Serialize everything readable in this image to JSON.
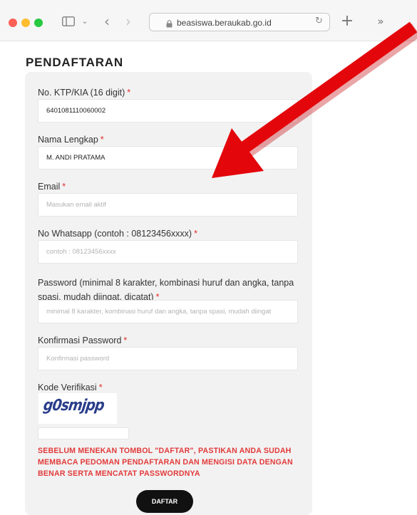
{
  "browser": {
    "url": "beasiswa.beraukab.go.id"
  },
  "page": {
    "title": "PENDAFTARAN"
  },
  "form": {
    "required_mark": "*",
    "ktp": {
      "label": "No. KTP/KIA (16 digit)",
      "value": "6401081110060002"
    },
    "name": {
      "label": "Nama Lengkap",
      "value": "M. ANDI PRATAMA"
    },
    "email": {
      "label": "Email",
      "placeholder": "Masukan email aktif"
    },
    "whatsapp": {
      "label": "No Whatsapp (contoh : 08123456xxxx)",
      "placeholder": "contoh : 08123456xxxx"
    },
    "password": {
      "label": "Password (minimal 8 karakter, kombinasi huruf dan angka, tanpa spasi, mudah diingat, dicatat)",
      "placeholder": "minimal 8 karakter, kombinasi huruf dan angka, tanpa spasi, mudah diingat"
    },
    "confirm_password": {
      "label": "Konfirmasi Password",
      "placeholder": "Konfirmasi password"
    },
    "captcha": {
      "label": "Kode Verifikasi",
      "image_text": "g0smjpp"
    },
    "warning": "SEBELUM MENEKAN TOMBOL \"DAFTAR\", PASTIKAN ANDA SUDAH MEMBACA PEDOMAN PENDAFTARAN DAN MENGISI DATA DENGAN BENAR SERTA MENCATAT PASSWORDNYA",
    "submit_label": "DAFTAR"
  },
  "colors": {
    "required": "#e02d2d",
    "warning": "#e23a3a",
    "button": "#111111",
    "annotation_arrow": "#e3060b"
  },
  "icons": [
    "sidebar-toggle-icon",
    "chevron-down-icon",
    "back-arrow-icon",
    "forward-arrow-icon",
    "lock-icon",
    "reload-icon",
    "new-tab-icon",
    "more-tabs-icon"
  ]
}
